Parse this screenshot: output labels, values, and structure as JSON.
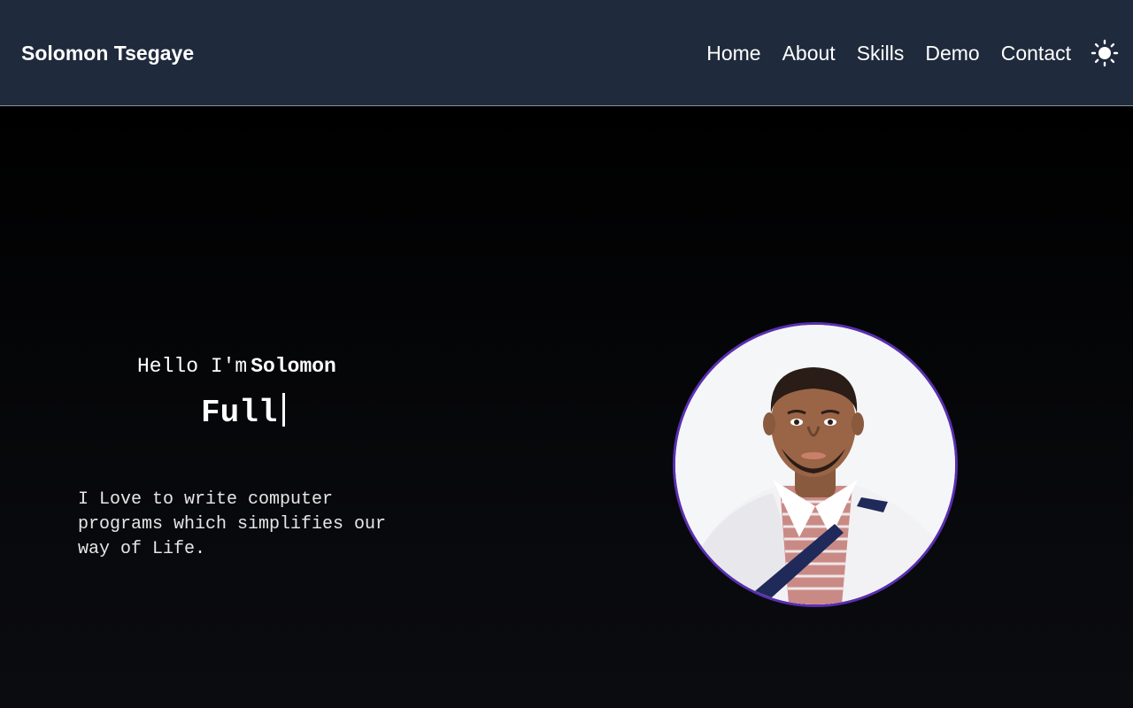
{
  "header": {
    "brand": "Solomon Tsegaye",
    "nav": [
      "Home",
      "About",
      "Skills",
      "Demo",
      "Contact"
    ],
    "theme_toggle_icon": "sun-icon"
  },
  "hero": {
    "greeting_prefix": "Hello I'm",
    "greeting_name": "Solomon",
    "typed_text": "Full",
    "tagline": "I Love to write computer programs which simplifies our way of Life.",
    "portrait_icon": "profile-photo"
  },
  "colors": {
    "navbar_bg": "#1f2a3c",
    "page_bg": "#000000",
    "portrait_border": "#5a2fb0",
    "text": "#ffffff"
  }
}
